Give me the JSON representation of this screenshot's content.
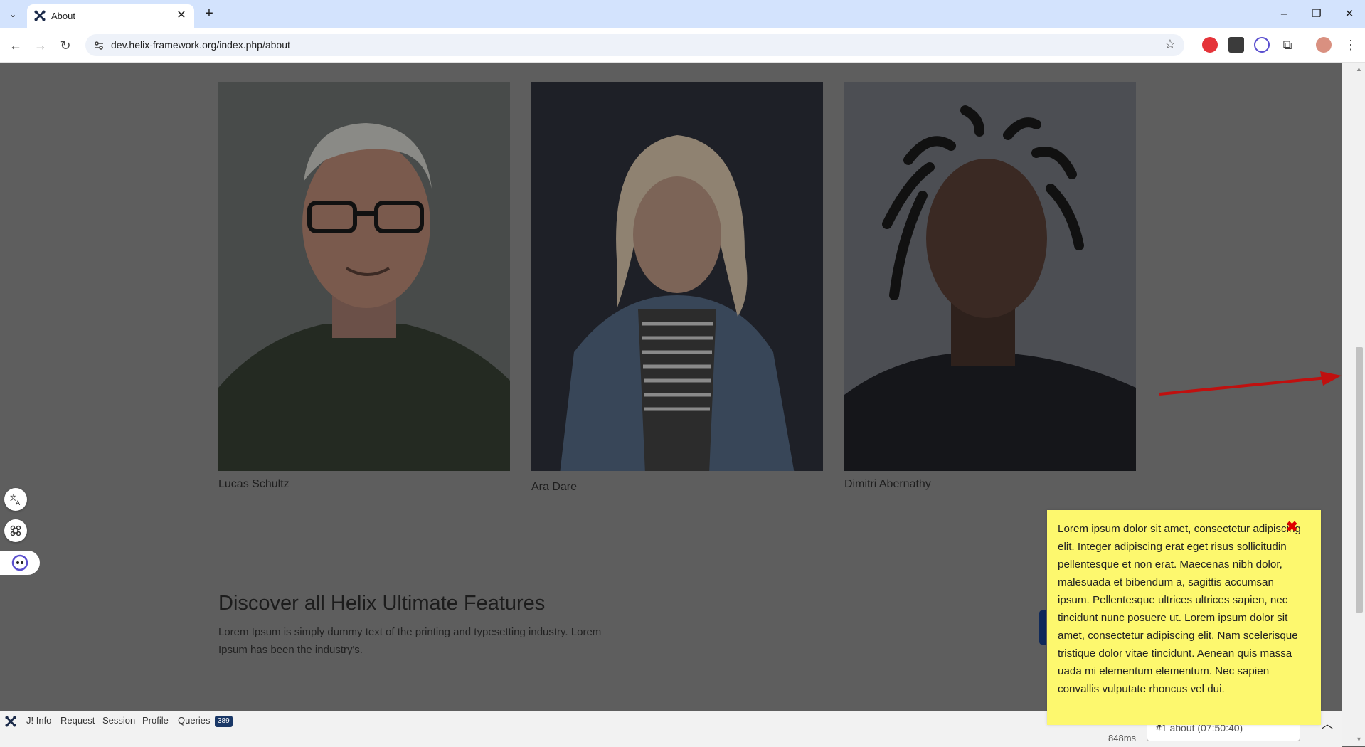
{
  "browser": {
    "tab_title": "About",
    "url": "dev.helix-framework.org/index.php/about",
    "new_tab_symbol": "+",
    "window_controls": [
      "–",
      "❐",
      "✕"
    ]
  },
  "team": {
    "members": [
      {
        "name": "Lucas Schultz"
      },
      {
        "name": "Ara Dare"
      },
      {
        "name": "Dimitri Abernathy"
      }
    ]
  },
  "features": {
    "title": "Discover all Helix Ultimate Features",
    "text": "Lorem Ipsum is simply dummy text of the printing and typesetting industry. Lorem Ipsum has been the industry's."
  },
  "notice": {
    "text": "Lorem ipsum dolor sit amet, consectetur adipiscing elit. Integer adipiscing erat eget risus sollicitudin pellentesque et non erat. Maecenas nibh dolor, malesuada et bibendum a, sagittis accumsan ipsum. Pellentesque ultrices ultrices sapien, nec tincidunt nunc posuere ut. Lorem ipsum dolor sit amet, consectetur adipiscing elit. Nam scelerisque tristique dolor vitae tincidunt. Aenean quis massa uada mi elementum elementum. Nec sapien convallis vulputate rhoncus vel dui.",
    "close_symbol": "✖"
  },
  "debugbar": {
    "items": [
      "J! Info",
      "Request",
      "Session",
      "Profile",
      "Queries"
    ],
    "queries_count": "389",
    "time": "848ms",
    "request_select": "#1 about (07:50:40)"
  },
  "colors": {
    "overlay": "#5e5e5e",
    "notice_bg": "#fdf86e",
    "close_red": "#e00000",
    "badge": "#1a3867"
  }
}
